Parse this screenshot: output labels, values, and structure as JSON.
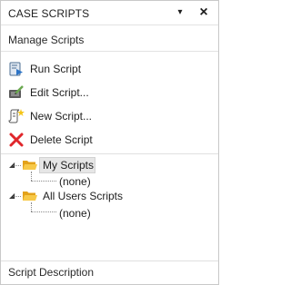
{
  "panel": {
    "title": "CASE SCRIPTS",
    "menu_glyph": "▾",
    "close_glyph": "×",
    "section_title": "Manage Scripts",
    "description_label": "Script Description"
  },
  "commands": [
    {
      "label": "Run Script",
      "icon": "run-script-icon"
    },
    {
      "label": "Edit Script...",
      "icon": "edit-script-icon"
    },
    {
      "label": "New Script...",
      "icon": "new-script-icon"
    },
    {
      "label": "Delete Script",
      "icon": "delete-icon"
    }
  ],
  "tree": {
    "nodes": [
      {
        "label": "My Scripts",
        "selected": true,
        "children": [
          {
            "label": "(none)"
          }
        ]
      },
      {
        "label": "All Users Scripts",
        "selected": false,
        "children": [
          {
            "label": "(none)"
          }
        ]
      }
    ]
  },
  "colors": {
    "accent_folder": "#f2b632",
    "delete_red": "#e0262b",
    "selection_bg": "#e6e6e6"
  }
}
